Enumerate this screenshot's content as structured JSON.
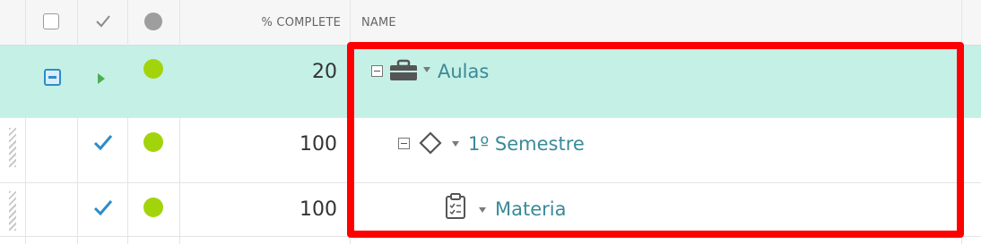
{
  "header": {
    "complete_label": "% COMPLETE",
    "name_label": "NAME"
  },
  "rows": [
    {
      "percent": "20",
      "name": "Aulas",
      "item_icon": "briefcase-icon",
      "status": "in-progress",
      "selected": true
    },
    {
      "percent": "100",
      "name": "1º Semestre",
      "item_icon": "diamond-milestone-icon",
      "status": "done",
      "selected": false
    },
    {
      "percent": "100",
      "name": "Materia",
      "item_icon": "clipboard-checklist-icon",
      "status": "done",
      "selected": false
    }
  ],
  "colors": {
    "selected_row": "#c5f0e6",
    "status_dot": "#a2d40b",
    "highlight_border": "#ff0000",
    "name_text": "#3a8a98",
    "check_blue": "#2e8cc8"
  }
}
